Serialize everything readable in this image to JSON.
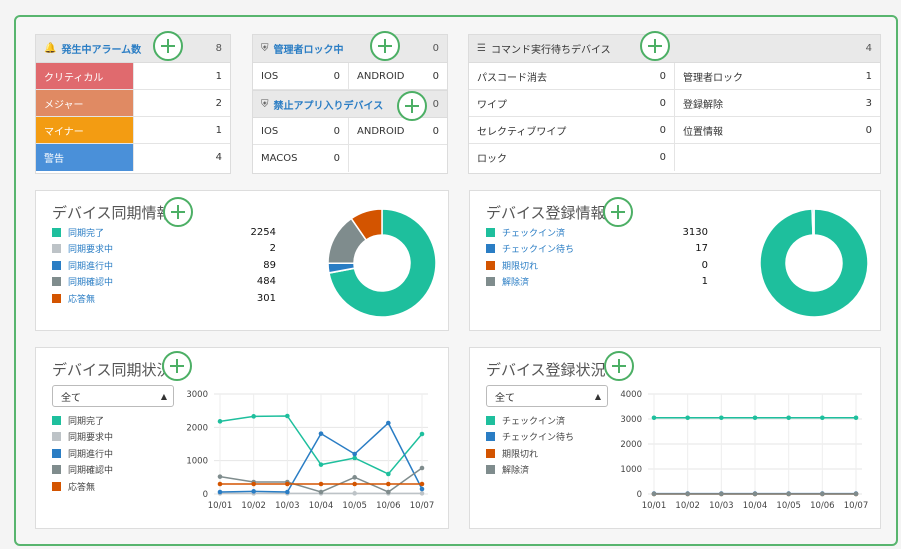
{
  "colors": {
    "accent_green": "#4caf65",
    "teal": "#1ebf9d",
    "blue": "#2a7dc4",
    "orange": "#d35400",
    "gray": "#7f8c8d",
    "lightgray": "#bdc3c7",
    "link": "#2a7dc4"
  },
  "alarm": {
    "title": "発生中アラーム数",
    "count": "8",
    "rows": [
      {
        "label": "クリティカル",
        "value": "1",
        "color": "#e06a6e"
      },
      {
        "label": "メジャー",
        "value": "2",
        "color": "#e08a63"
      },
      {
        "label": "マイナー",
        "value": "1",
        "color": "#f39c12"
      },
      {
        "label": "警告",
        "value": "4",
        "color": "#4a90d9"
      }
    ]
  },
  "admin_lock": {
    "title": "管理者ロック中",
    "count": "0",
    "ios": "IOS",
    "ios_val": "0",
    "android": "ANDROID",
    "android_val": "0"
  },
  "banned_app": {
    "title": "禁止アプリ入りデバイス",
    "count": "0",
    "ios": "IOS",
    "ios_val": "0",
    "android": "ANDROID",
    "android_val": "0",
    "macos": "MACOS",
    "macos_val": "0"
  },
  "commands": {
    "title": "コマンド実行待ちデバイス",
    "count": "4",
    "rows": [
      {
        "l1": "パスコード消去",
        "v1": "0",
        "l2": "管理者ロック",
        "v2": "1"
      },
      {
        "l1": "ワイプ",
        "v1": "0",
        "l2": "登録解除",
        "v2": "3"
      },
      {
        "l1": "セレクティブワイプ",
        "v1": "0",
        "l2": "位置情報",
        "v2": "0"
      },
      {
        "l1": "ロック",
        "v1": "0",
        "l2": "",
        "v2": ""
      }
    ]
  },
  "sync_info": {
    "title": "デバイス同期情報",
    "items": [
      {
        "label": "同期完了",
        "value": "2254",
        "color": "#1ebf9d"
      },
      {
        "label": "同期要求中",
        "value": "2",
        "color": "#bdc3c7"
      },
      {
        "label": "同期進行中",
        "value": "89",
        "color": "#2a7dc4"
      },
      {
        "label": "同期確認中",
        "value": "484",
        "color": "#7f8c8d"
      },
      {
        "label": "応答無",
        "value": "301",
        "color": "#d35400"
      }
    ]
  },
  "reg_info": {
    "title": "デバイス登録情報",
    "items": [
      {
        "label": "チェックイン済",
        "value": "3130",
        "color": "#1ebf9d"
      },
      {
        "label": "チェックイン待ち",
        "value": "17",
        "color": "#2a7dc4"
      },
      {
        "label": "期限切れ",
        "value": "0",
        "color": "#d35400"
      },
      {
        "label": "解除済",
        "value": "1",
        "color": "#7f8c8d"
      }
    ]
  },
  "sync_status": {
    "title": "デバイス同期状況",
    "filter": "全て",
    "legend": [
      "同期完了",
      "同期要求中",
      "同期進行中",
      "同期確認中",
      "応答無"
    ]
  },
  "reg_status": {
    "title": "デバイス登録状況",
    "filter": "全て",
    "legend": [
      "チェックイン済",
      "チェックイン待ち",
      "期限切れ",
      "解除済"
    ]
  },
  "chart_data": [
    {
      "type": "pie",
      "title": "デバイス同期情報",
      "categories": [
        "同期完了",
        "同期要求中",
        "同期進行中",
        "同期確認中",
        "応答無"
      ],
      "values": [
        2254,
        2,
        89,
        484,
        301
      ],
      "colors": [
        "#1ebf9d",
        "#bdc3c7",
        "#2a7dc4",
        "#7f8c8d",
        "#d35400"
      ]
    },
    {
      "type": "pie",
      "title": "デバイス登録情報",
      "categories": [
        "チェックイン済",
        "チェックイン待ち",
        "期限切れ",
        "解除済"
      ],
      "values": [
        3130,
        17,
        0,
        1
      ],
      "colors": [
        "#1ebf9d",
        "#2a7dc4",
        "#d35400",
        "#7f8c8d"
      ]
    },
    {
      "type": "line",
      "title": "デバイス同期状況",
      "x": [
        "10/01",
        "10/02",
        "10/03",
        "10/04",
        "10/05",
        "10/06",
        "10/07"
      ],
      "ylim": [
        0,
        3000
      ],
      "yticks": [
        0,
        1000,
        2000,
        3000
      ],
      "grid": true,
      "series": [
        {
          "name": "同期完了",
          "color": "#1ebf9d",
          "values": [
            2180,
            2330,
            2340,
            880,
            1080,
            600,
            1800
          ]
        },
        {
          "name": "同期要求中",
          "color": "#bdc3c7",
          "values": [
            20,
            20,
            20,
            20,
            20,
            20,
            20
          ]
        },
        {
          "name": "同期進行中",
          "color": "#2a7dc4",
          "values": [
            60,
            80,
            60,
            1810,
            1200,
            2130,
            150
          ]
        },
        {
          "name": "同期確認中",
          "color": "#7f8c8d",
          "values": [
            520,
            360,
            360,
            60,
            500,
            60,
            780
          ]
        },
        {
          "name": "応答無",
          "color": "#d35400",
          "values": [
            300,
            300,
            300,
            300,
            300,
            300,
            300
          ]
        }
      ]
    },
    {
      "type": "line",
      "title": "デバイス登録状況",
      "x": [
        "10/01",
        "10/02",
        "10/03",
        "10/04",
        "10/05",
        "10/06",
        "10/07"
      ],
      "ylim": [
        0,
        4000
      ],
      "yticks": [
        0,
        1000,
        2000,
        3000,
        4000
      ],
      "grid": true,
      "series": [
        {
          "name": "チェックイン済",
          "color": "#1ebf9d",
          "values": [
            3050,
            3050,
            3050,
            3050,
            3050,
            3050,
            3050
          ]
        },
        {
          "name": "チェックイン待ち",
          "color": "#2a7dc4",
          "values": [
            17,
            17,
            17,
            17,
            17,
            17,
            17
          ]
        },
        {
          "name": "期限切れ",
          "color": "#d35400",
          "values": [
            0,
            0,
            0,
            0,
            0,
            0,
            0
          ]
        },
        {
          "name": "解除済",
          "color": "#7f8c8d",
          "values": [
            1,
            1,
            1,
            1,
            1,
            1,
            1
          ]
        }
      ]
    }
  ]
}
